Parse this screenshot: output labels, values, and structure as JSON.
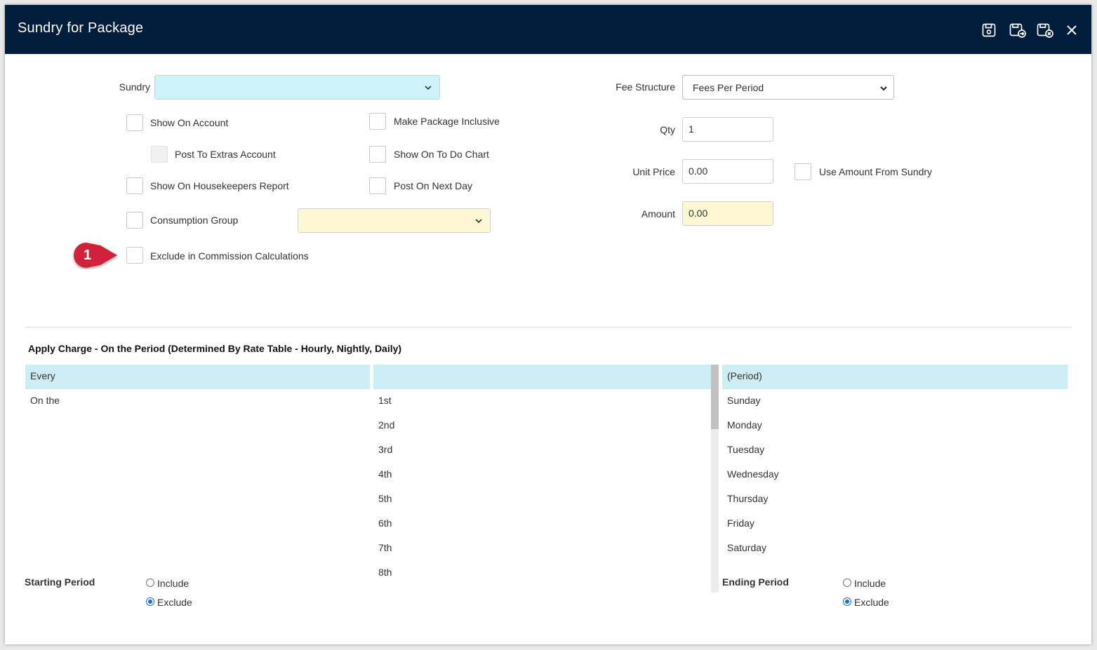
{
  "window": {
    "title": "Sundry for Package",
    "icons": [
      "save-icon",
      "save-new-icon",
      "save-close-icon",
      "close-icon"
    ]
  },
  "form": {
    "sundry_label": "Sundry",
    "sundry_value": "",
    "fee_structure_label": "Fee Structure",
    "fee_structure_value": "Fees Per Period",
    "qty_label": "Qty",
    "qty_value": "1",
    "unit_price_label": "Unit Price",
    "unit_price_value": "0.00",
    "use_amount_label": "Use Amount From Sundry",
    "amount_label": "Amount",
    "amount_value": "0.00",
    "consumption_group_value": "",
    "colors": {
      "sundry_bg": "#cef4fa",
      "consumption_bg": "#fdf7d3",
      "amount_bg": "#fdf7d3"
    }
  },
  "checkboxes": {
    "show_on_account": "Show On Account",
    "make_package_inclusive": "Make Package Inclusive",
    "post_to_extras": "Post To Extras Account",
    "show_on_todo": "Show On To Do Chart",
    "show_on_housekeepers": "Show On Housekeepers Report",
    "post_on_next_day": "Post On Next Day",
    "consumption_group": "Consumption Group",
    "exclude_commission": "Exclude in Commission Calculations"
  },
  "marker": {
    "number": "1",
    "color": "#d0223a"
  },
  "apply_charge": {
    "title": "Apply Charge - On the Period (Determined By Rate Table - Hourly, Nightly, Daily)",
    "col1": [
      "Every",
      "On the"
    ],
    "col2": [
      "",
      "1st",
      "2nd",
      "3rd",
      "4th",
      "5th",
      "6th",
      "7th",
      "8th"
    ],
    "col3": [
      "(Period)",
      "Sunday",
      "Monday",
      "Tuesday",
      "Wednesday",
      "Thursday",
      "Friday",
      "Saturday"
    ]
  },
  "starting_period": {
    "label": "Starting Period",
    "include": "Include",
    "exclude": "Exclude",
    "selected": "Exclude"
  },
  "ending_period": {
    "label": "Ending Period",
    "include": "Include",
    "exclude": "Exclude",
    "selected": "Exclude"
  }
}
